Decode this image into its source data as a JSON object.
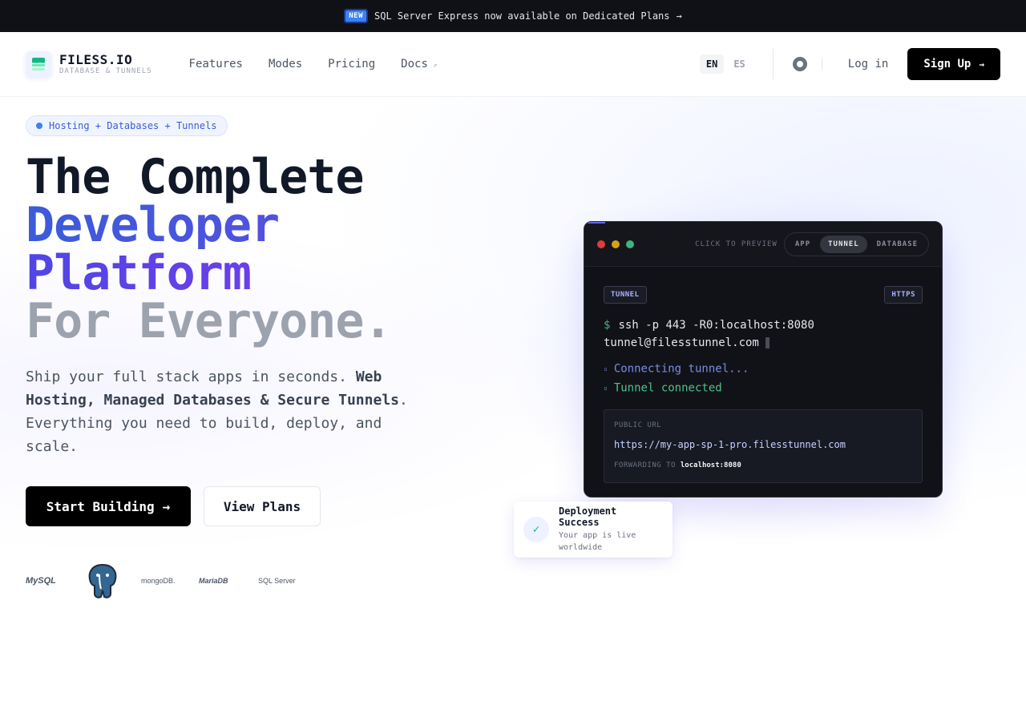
{
  "announcement": {
    "badge": "NEW",
    "message": "SQL Server Express now available on Dedicated Plans",
    "arrow": "→"
  },
  "header": {
    "logo_name": "FILESS.IO",
    "logo_sub": "DATABASE & TUNNELS",
    "nav": [
      {
        "label": "Features"
      },
      {
        "label": "Modes"
      },
      {
        "label": "Pricing"
      },
      {
        "label": "Docs",
        "external": "↗"
      }
    ],
    "languages": [
      {
        "code": "EN",
        "active": true
      },
      {
        "code": "ES",
        "active": false
      }
    ],
    "github_icon": "github-icon",
    "login": "Log in",
    "signup": "Sign Up",
    "signup_arrow": "→"
  },
  "hero": {
    "pill": "Hosting + Databases + Tunnels",
    "title": [
      "The Complete",
      "Developer",
      "Platform",
      "For Everyone."
    ],
    "desc_pre": "Ship your full stack apps in seconds. ",
    "desc_bold": "Web Hosting, Managed Databases & Secure Tunnels",
    "desc_post": ". Everything you need to build, deploy, and scale.",
    "cta_primary": "Start Building",
    "cta_primary_arrow": "→",
    "cta_secondary": "View Plans",
    "logos": [
      "MySQL",
      "PostgreSQL",
      "mongoDB.",
      "MariaDB",
      "SQL Server"
    ]
  },
  "terminal": {
    "click_to_preview": "CLICK TO PREVIEW",
    "tabs": [
      {
        "label": "APP",
        "active": false
      },
      {
        "label": "TUNNEL",
        "active": true
      },
      {
        "label": "DATABASE",
        "active": false
      }
    ],
    "tag_left": "TUNNEL",
    "tag_right": "HTTPS",
    "prompt": "$",
    "command_line1": "ssh -p 443 -R0:localhost:8080",
    "command_line2": "tunnel@filesstunnel.com",
    "status_connecting": "Connecting tunnel...",
    "status_connected": "Tunnel connected",
    "public_url_label": "PUBLIC URL",
    "public_url": "https://my-app-sp-1-pro.filesstunnel.com",
    "forwarding_label": "FORWARDING TO",
    "forwarding_target": "localhost:8080"
  },
  "toast": {
    "title": "Deployment Success",
    "body": "Your app is live worldwide",
    "check": "✓"
  },
  "colors": {
    "accent": "#3b5bdb",
    "purple": "#5b3fe0",
    "dark": "#0f1117",
    "success": "#3fb37f"
  }
}
